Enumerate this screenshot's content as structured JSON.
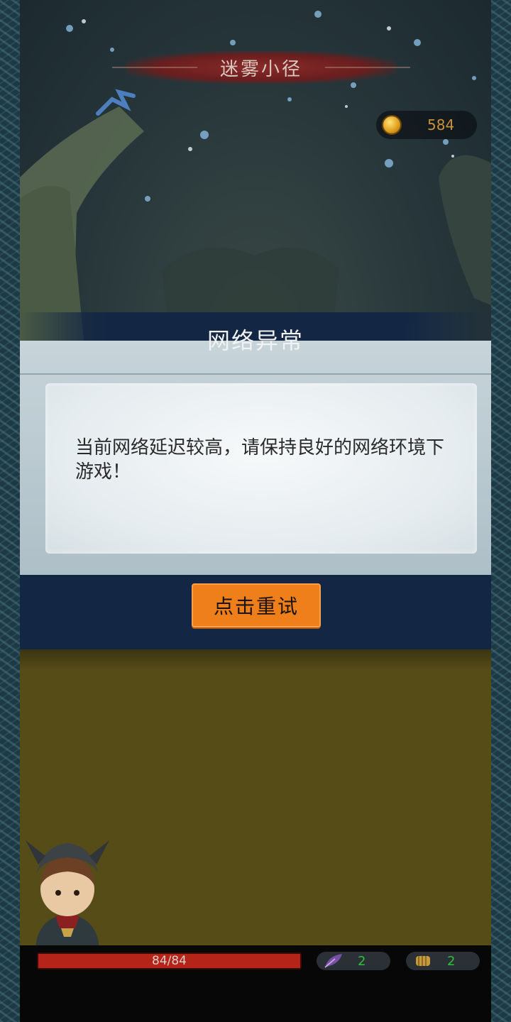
{
  "location": {
    "title": "迷雾小径"
  },
  "currency": {
    "icon": "gold-coin-icon",
    "amount": "584"
  },
  "dialog": {
    "title": "网络异常",
    "message": "当前网络延迟较高，请保持良好的网络环境下游戏！",
    "retry_label": "点击重试",
    "accent": "#ee7f1a"
  },
  "player": {
    "hp": {
      "text": "84/84",
      "fraction": 1.0
    },
    "stats": [
      {
        "icon": "feather-icon",
        "value": "2"
      },
      {
        "icon": "fist-icon",
        "value": "2"
      }
    ]
  },
  "colors": {
    "hp": "#b52418",
    "stat_value": "#2fbf38",
    "dialog_band": "#132744",
    "ground": "#564c18"
  }
}
